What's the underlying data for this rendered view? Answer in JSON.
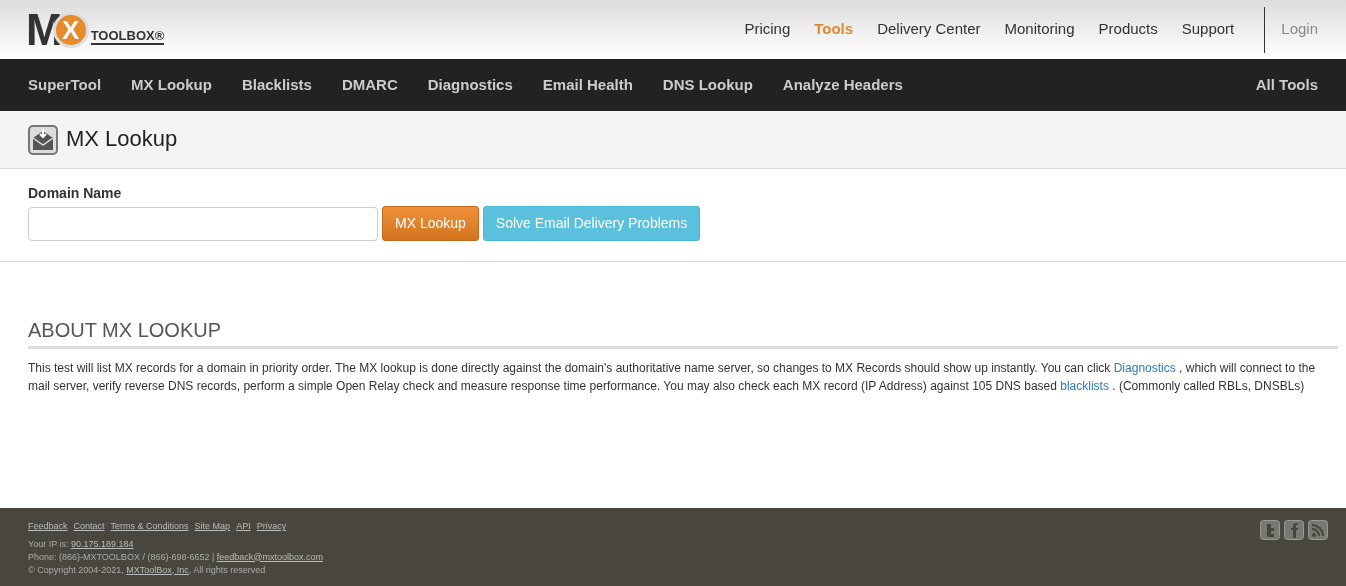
{
  "logo": {
    "big": "M",
    "circle": "X",
    "word": "TOOLBOX®"
  },
  "top_nav": [
    {
      "label": "Pricing",
      "selected": false
    },
    {
      "label": "Tools",
      "selected": true
    },
    {
      "label": "Delivery Center",
      "selected": false
    },
    {
      "label": "Monitoring",
      "selected": false
    },
    {
      "label": "Products",
      "selected": false
    },
    {
      "label": "Support",
      "selected": false
    }
  ],
  "login": "Login",
  "tool_nav": [
    "SuperTool",
    "MX Lookup",
    "Blacklists",
    "DMARC",
    "Diagnostics",
    "Email Health",
    "DNS Lookup",
    "Analyze Headers"
  ],
  "all_tools": "All Tools",
  "page_title": "MX Lookup",
  "form": {
    "label": "Domain Name",
    "buttons": [
      {
        "label": "MX Lookup",
        "kind": "primary"
      },
      {
        "label": "Solve Email Delivery Problems",
        "kind": "info"
      }
    ]
  },
  "about": {
    "heading": "ABOUT MX LOOKUP",
    "parts": [
      {
        "kind": "text",
        "text": "This test will list MX records for a domain in priority order. The MX lookup is done directly against the domain's authoritative name server, so changes to MX Records should show up instantly. You can click "
      },
      {
        "kind": "link",
        "text": "Diagnostics"
      },
      {
        "kind": "text",
        "text": " , which will connect to the mail server, verify reverse DNS records, perform a simple Open Relay check and measure response time performance. You may also check each MX record (IP Address) against 105 DNS based "
      },
      {
        "kind": "link",
        "text": "blacklists"
      },
      {
        "kind": "text",
        "text": " . (Commonly called RBLs, DNSBLs)"
      }
    ]
  },
  "footer": {
    "links": [
      "Feedback",
      "Contact",
      "Terms & Conditions",
      "Site Map",
      "API",
      "Privacy"
    ],
    "lines": [
      [
        {
          "kind": "text",
          "text": "Your IP is: "
        },
        {
          "kind": "link",
          "text": "90.175.189.184"
        }
      ],
      [
        {
          "kind": "text",
          "text": "Phone: (866)-MXTOOLBOX / (866)-698-6652 | "
        },
        {
          "kind": "link",
          "text": "feedback@mxtoolbox.com"
        }
      ],
      [
        {
          "kind": "text",
          "text": "© Copyright 2004-2021, "
        },
        {
          "kind": "link",
          "text": "MXToolBox, Inc"
        },
        {
          "kind": "text",
          "text": ", All rights reserved"
        }
      ]
    ]
  }
}
